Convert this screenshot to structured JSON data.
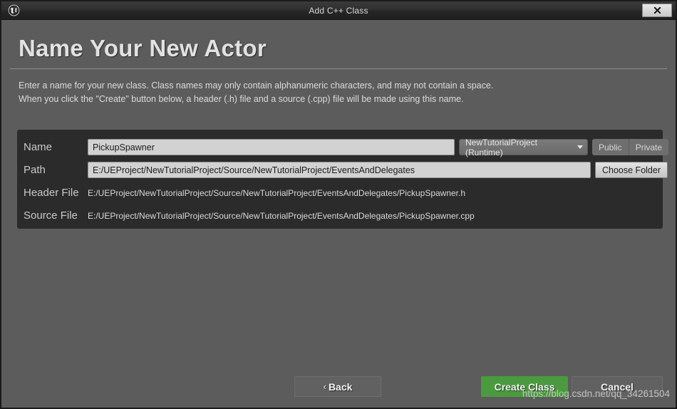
{
  "titlebar": {
    "title": "Add C++ Class",
    "logo_icon": "unreal-engine-logo",
    "close_icon": "close-icon"
  },
  "heading": "Name Your New Actor",
  "description": {
    "line1": "Enter a name for your new class. Class names may only contain alphanumeric characters, and may not contain a space.",
    "line2": "When you click the \"Create\" button below, a header (.h) file and a source (.cpp) file will be made using this name."
  },
  "form": {
    "name": {
      "label": "Name",
      "value": "PickupSpawner",
      "placeholder": ""
    },
    "module_dropdown": {
      "value": "NewTutorialProject (Runtime)",
      "caret_icon": "chevron-down-icon"
    },
    "visibility": {
      "public_label": "Public",
      "private_label": "Private"
    },
    "path": {
      "label": "Path",
      "value": "E:/UEProject/NewTutorialProject/Source/NewTutorialProject/EventsAndDelegates",
      "placeholder": ""
    },
    "choose_folder_label": "Choose Folder",
    "header_file": {
      "label": "Header File",
      "value": "E:/UEProject/NewTutorialProject/Source/NewTutorialProject/EventsAndDelegates/PickupSpawner.h"
    },
    "source_file": {
      "label": "Source File",
      "value": "E:/UEProject/NewTutorialProject/Source/NewTutorialProject/EventsAndDelegates/PickupSpawner.cpp"
    }
  },
  "footer": {
    "back_label": "Back",
    "back_chevron": "‹",
    "create_label": "Create Class",
    "cancel_label": "Cancel"
  },
  "watermark": "https://blog.csdn.net/qq_34261504",
  "colors": {
    "dialog_bg": "#5c5c5c",
    "panel_bg": "#2b2b2b",
    "accent_green": "#4a9b3f",
    "textbox_bg": "#d2d2d2"
  }
}
